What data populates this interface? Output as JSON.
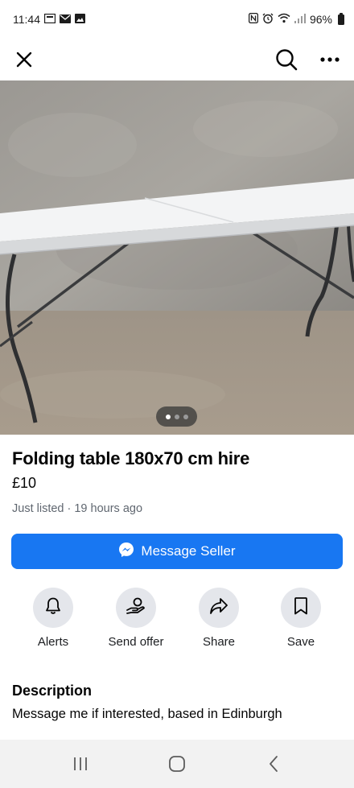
{
  "status_bar": {
    "time": "11:44",
    "battery": "96%",
    "left_icons": [
      "gallery-icon",
      "mail-icon",
      "image-icon"
    ],
    "right_icons": [
      "nfc-icon",
      "alarm-icon",
      "wifi-icon",
      "signal-icon",
      "battery-icon"
    ]
  },
  "top_bar": {
    "close_icon": "close-icon",
    "search_icon": "search-icon",
    "more_icon": "more-icon"
  },
  "photo": {
    "description_icon": "folding-table-photo",
    "carousel_count": 3,
    "carousel_active": 1
  },
  "listing": {
    "title": "Folding table 180x70 cm hire",
    "price": "£10",
    "listed": "Just listed · 19 hours ago"
  },
  "message_button": {
    "label": "Message Seller",
    "icon": "messenger-icon",
    "color": "#1877f2"
  },
  "actions": [
    {
      "label": "Alerts",
      "icon": "bell-icon"
    },
    {
      "label": "Send offer",
      "icon": "offer-icon"
    },
    {
      "label": "Share",
      "icon": "share-icon"
    },
    {
      "label": "Save",
      "icon": "bookmark-icon"
    }
  ],
  "description": {
    "heading": "Description",
    "text": "Message me if interested, based in Edinburgh"
  },
  "nav_bar": {
    "buttons": [
      "recents-icon",
      "home-icon",
      "back-icon"
    ]
  }
}
